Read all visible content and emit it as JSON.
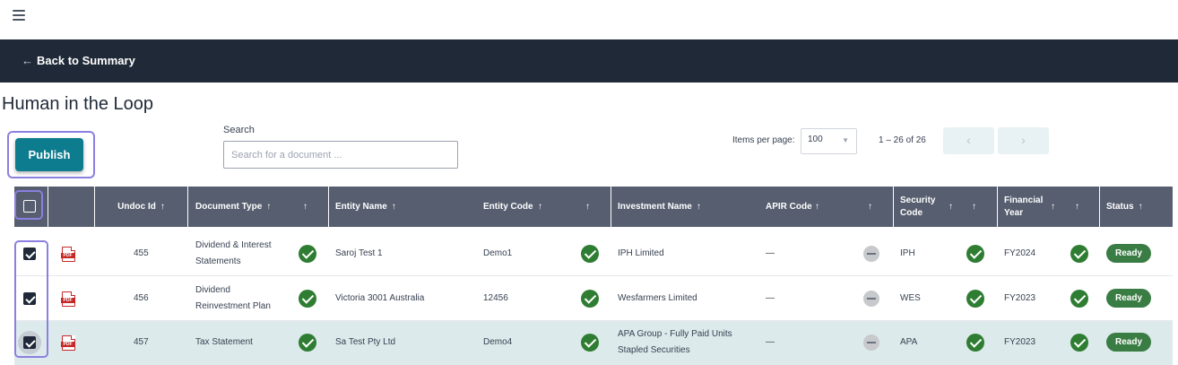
{
  "nav": {
    "back_label": "Back to Summary"
  },
  "page": {
    "title": "Human in the Loop"
  },
  "toolbar": {
    "publish_label": "Publish",
    "search_label": "Search",
    "search_placeholder": "Search for a document ...",
    "search_value": "",
    "items_per_page_label": "Items per page:",
    "items_per_page_value": "100",
    "range_label": "1 – 26 of 26"
  },
  "table": {
    "columns": {
      "undoc_id": "Undoc Id",
      "document_type": "Document Type",
      "entity_name": "Entity Name",
      "entity_code": "Entity Code",
      "investment_name": "Investment Name",
      "apir_code": "APIR Code",
      "security_code_line1": "Security",
      "security_code_line2": "Code",
      "financial_year_line1": "Financial",
      "financial_year_line2": "Year",
      "status": "Status"
    },
    "rows": [
      {
        "checked": true,
        "undoc_id": "455",
        "document_type_line1": "Dividend & Interest",
        "document_type_line2": "Statements",
        "entity_name": "Saroj Test 1",
        "entity_code": "Demo1",
        "investment_name_line1": "IPH Limited",
        "investment_name_line2": "",
        "apir_code": "—",
        "security_code": "IPH",
        "financial_year": "FY2024",
        "status": "Ready"
      },
      {
        "checked": true,
        "undoc_id": "456",
        "document_type_line1": "Dividend",
        "document_type_line2": "Reinvestment Plan",
        "entity_name": "Victoria 3001 Australia",
        "entity_code": "12456",
        "investment_name_line1": "Wesfarmers Limited",
        "investment_name_line2": "",
        "apir_code": "—",
        "security_code": "WES",
        "financial_year": "FY2023",
        "status": "Ready"
      },
      {
        "checked": true,
        "undoc_id": "457",
        "document_type_line1": "Tax Statement",
        "document_type_line2": "",
        "entity_name": "Sa Test Pty Ltd",
        "entity_code": "Demo4",
        "investment_name_line1": "APA Group - Fully Paid Units",
        "investment_name_line2": "Stapled Securities",
        "apir_code": "—",
        "security_code": "APA",
        "financial_year": "FY2023",
        "status": "Ready"
      }
    ]
  },
  "icons": {
    "menu": "hamburger-menu-icon",
    "back": "arrow-left-icon",
    "file": "pdf-file-icon",
    "valid": "check-circle-icon",
    "na": "minus-circle-icon",
    "sort": "arrow-up-icon"
  },
  "colors": {
    "navbar": "#1f2937",
    "header": "#565e6f",
    "primary": "#0e7c8f",
    "success": "#2e7d32",
    "status_ready": "#3a7d44",
    "highlight_row": "#ddeaeb",
    "focus_outline": "#8b7fe0",
    "pdf_red": "#c62828"
  }
}
